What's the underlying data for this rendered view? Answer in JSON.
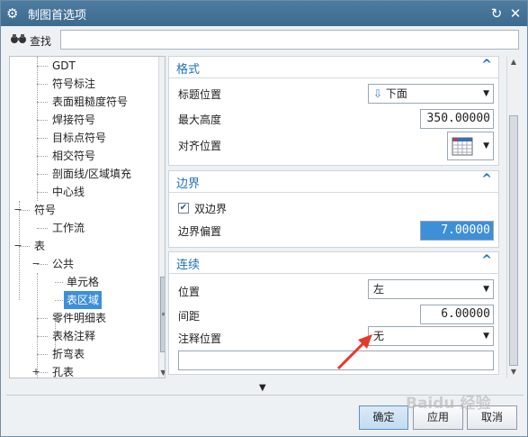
{
  "window": {
    "title": "制图首选项",
    "icons": [
      "gear-icon",
      "reset-icon",
      "close-icon"
    ]
  },
  "search": {
    "label": "查找",
    "value": "",
    "icon": "binoculars-icon"
  },
  "tree": [
    {
      "label": "GDT",
      "level": 2
    },
    {
      "label": "符号标注",
      "level": 2
    },
    {
      "label": "表面粗糙度符号",
      "level": 2
    },
    {
      "label": "焊接符号",
      "level": 2
    },
    {
      "label": "目标点符号",
      "level": 2
    },
    {
      "label": "相交符号",
      "level": 2
    },
    {
      "label": "剖面线/区域填充",
      "level": 2
    },
    {
      "label": "中心线",
      "level": 2
    },
    {
      "label": "符号",
      "level": 0,
      "toggle": "−"
    },
    {
      "label": "工作流",
      "level": 2
    },
    {
      "label": "表",
      "level": 0,
      "toggle": "−"
    },
    {
      "label": "公共",
      "level": 1,
      "toggle": "−"
    },
    {
      "label": "单元格",
      "level": 3
    },
    {
      "label": "表区域",
      "level": 3,
      "selected": true
    },
    {
      "label": "零件明细表",
      "level": 2
    },
    {
      "label": "表格注释",
      "level": 2
    },
    {
      "label": "折弯表",
      "level": 2
    },
    {
      "label": "孔表",
      "level": 2,
      "toggle": "+"
    }
  ],
  "format": {
    "title": "格式",
    "title_position_label": "标题位置",
    "title_position_value": "下面",
    "max_height_label": "最大高度",
    "max_height_value": "350.00000",
    "align_label": "对齐位置"
  },
  "border": {
    "title": "边界",
    "double_border_label": "双边界",
    "double_border_checked": true,
    "offset_label": "边界偏置",
    "offset_value": "7.00000"
  },
  "continuation": {
    "title": "连续",
    "position_label": "位置",
    "position_value": "左",
    "spacing_label": "间距",
    "spacing_value": "6.00000",
    "note_position_label": "注释位置",
    "note_position_value": "无",
    "note_text": ""
  },
  "buttons": {
    "ok": "确定",
    "apply": "应用",
    "cancel": "取消"
  },
  "watermark": "Baidu 经验",
  "colors": {
    "accent": "#1e72b8",
    "selection": "#3d8fd8",
    "titlebar": "#4e7ba0",
    "annotation_arrow": "#e23b2e"
  }
}
